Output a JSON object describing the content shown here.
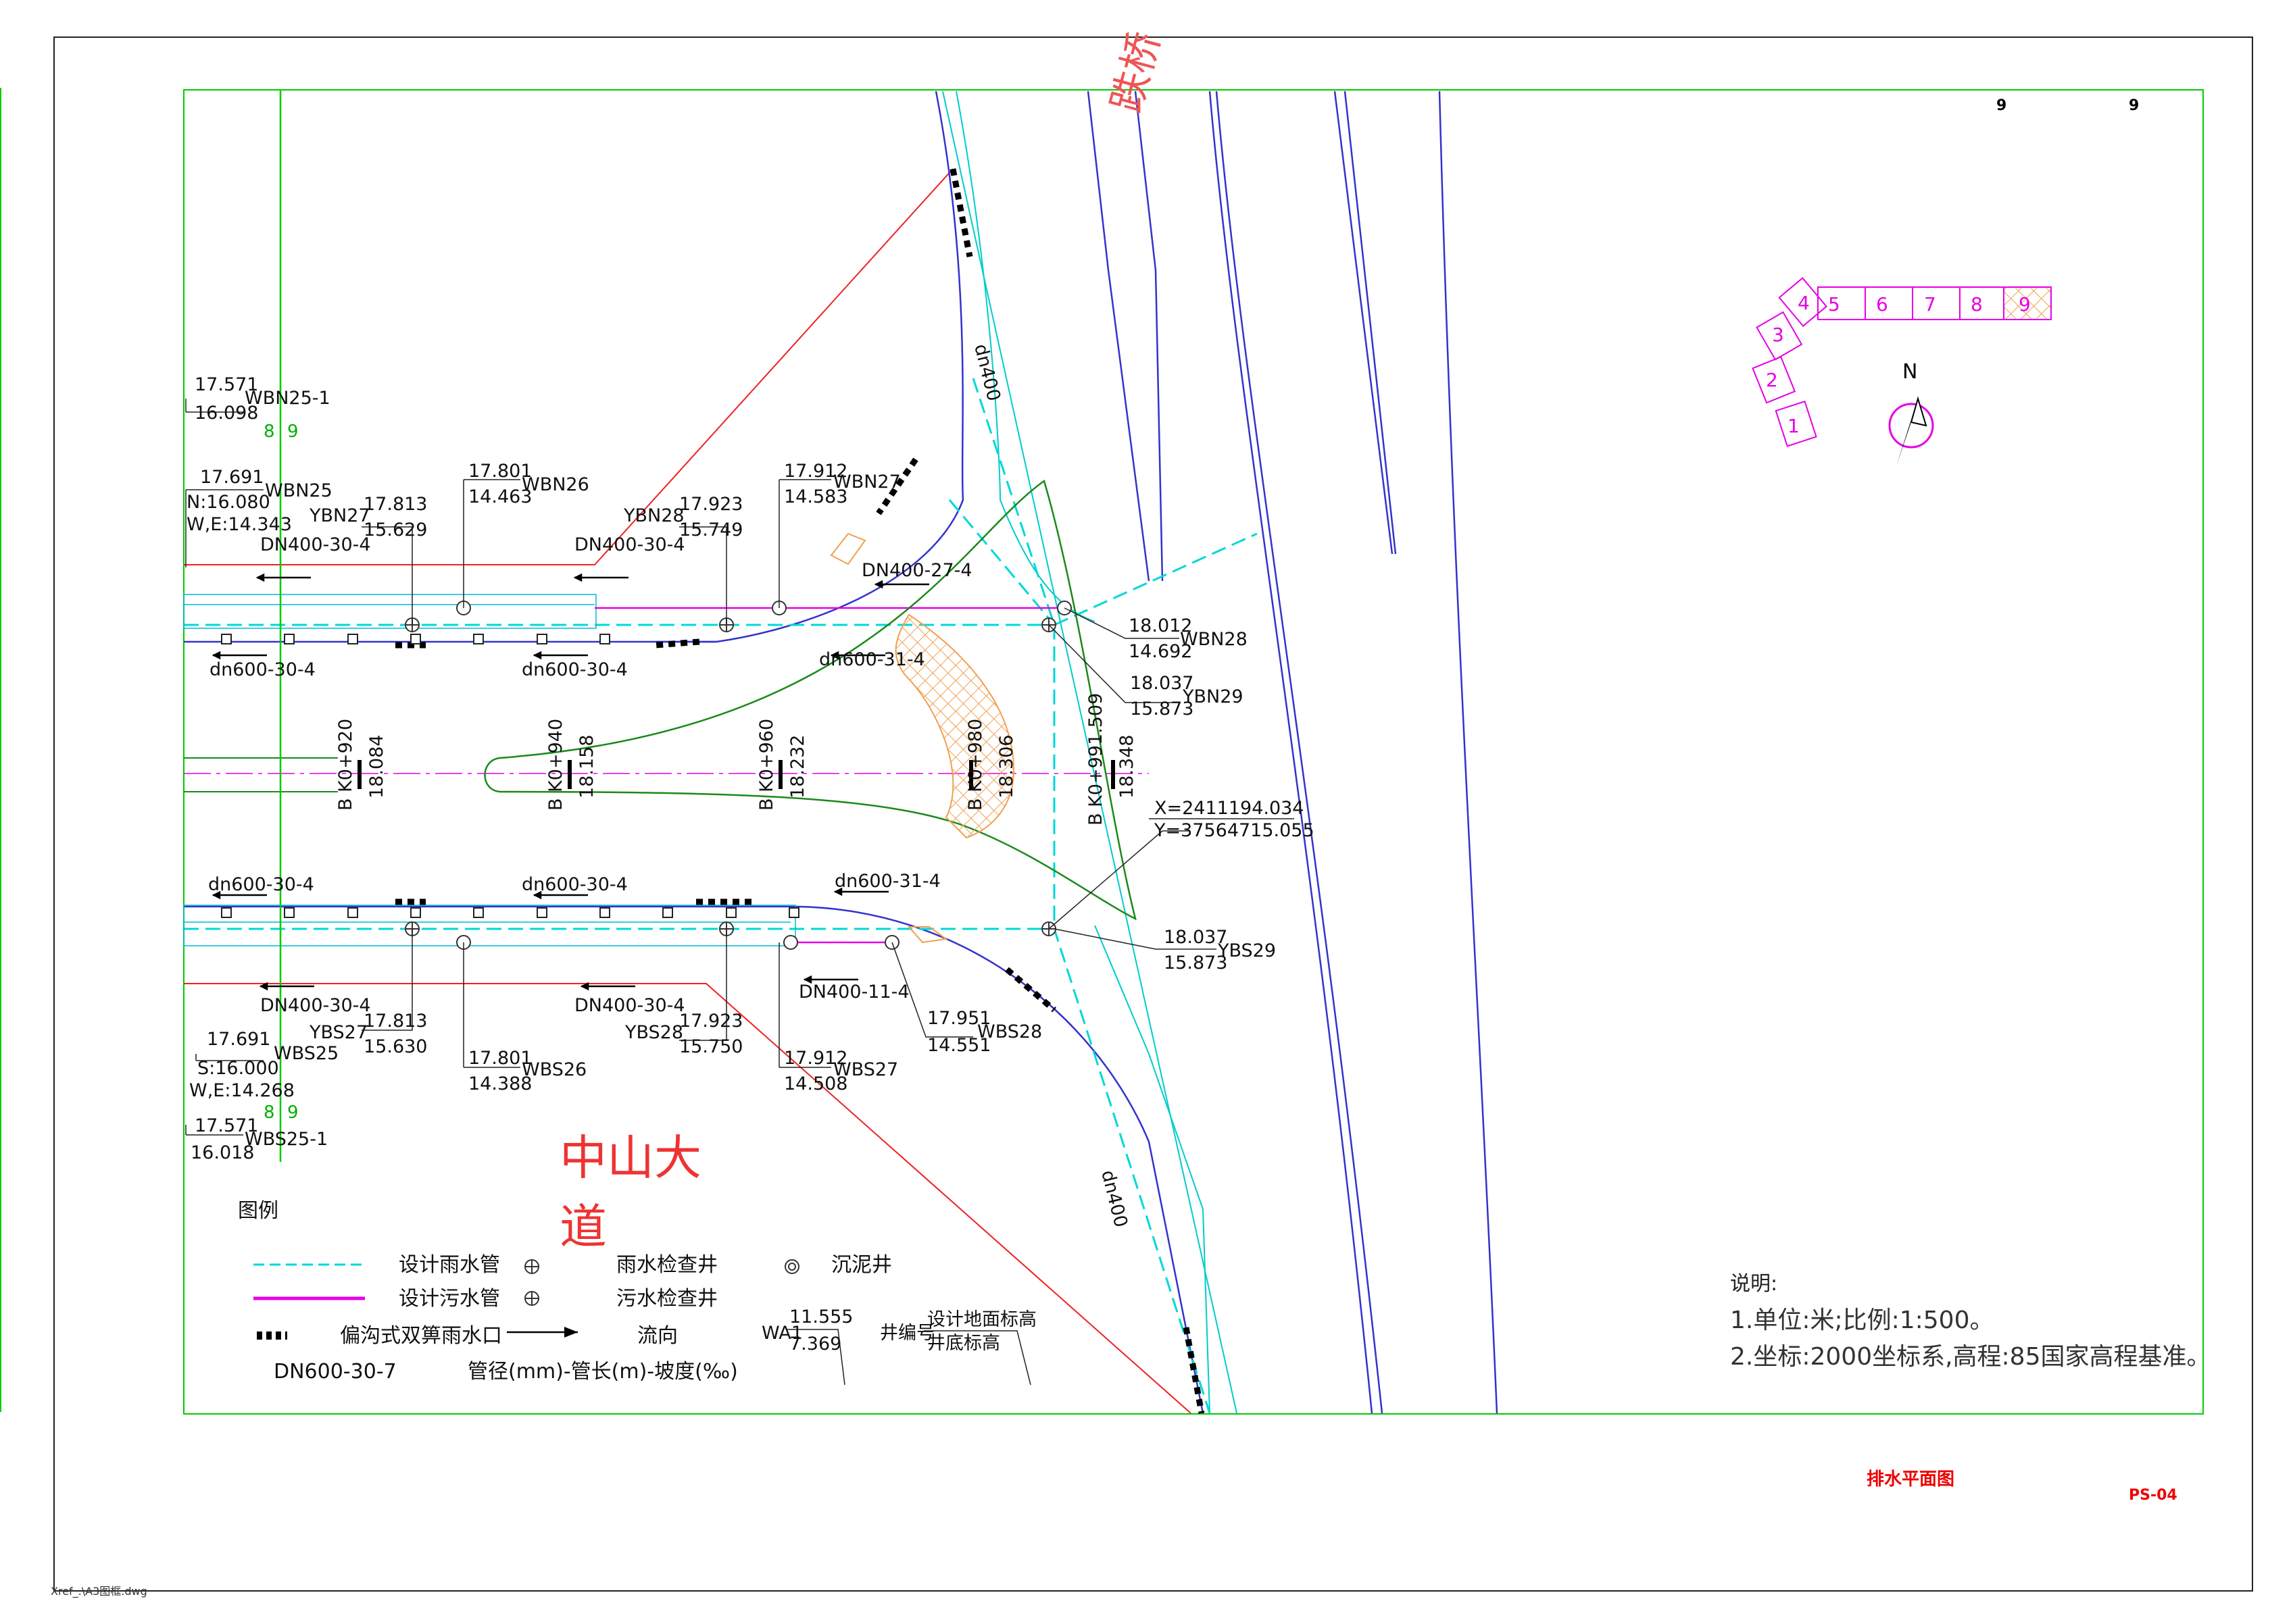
{
  "page": {
    "sheet_title": "排水平面图",
    "sheet_code": "PS-04",
    "xref_path": "Xref_.\\A3图框.dwg",
    "corner_marks": [
      "9",
      "9"
    ]
  },
  "place_names": {
    "road_name_line1": "中山大",
    "road_name_line2": "道",
    "top_text": "跌桥"
  },
  "key_plan": {
    "segments": [
      "1",
      "2",
      "3",
      "4",
      "5",
      "6",
      "7",
      "8",
      "9"
    ],
    "north_label": "N"
  },
  "sheet_match": [
    "8",
    "9"
  ],
  "stations": [
    {
      "chainage": "B K0+920",
      "elev": "18.084"
    },
    {
      "chainage": "B K0+940",
      "elev": "18.158"
    },
    {
      "chainage": "B K0+960",
      "elev": "18.232"
    },
    {
      "chainage": "B K0+980",
      "elev": "18.306"
    },
    {
      "chainage": "B K0+991.509",
      "elev": "18.348"
    }
  ],
  "coordinates": {
    "x": "X=2411194.034",
    "y": "Y=37564715.055"
  },
  "north_wells": [
    {
      "top": "17.571",
      "bottom": "16.098",
      "id": "WBN25-1"
    },
    {
      "top": "17.691",
      "bottom": "N:16.080",
      "bottom2": "W,E:14.343",
      "id": "WBN25"
    },
    {
      "top": "17.813",
      "bottom": "15.629",
      "id": "YBN27"
    },
    {
      "top": "17.801",
      "bottom": "14.463",
      "id": "WBN26"
    },
    {
      "top": "17.923",
      "bottom": "15.749",
      "id": "YBN28"
    },
    {
      "top": "17.912",
      "bottom": "14.583",
      "id": "WBN27"
    },
    {
      "top": "18.012",
      "bottom": "14.692",
      "id": "WBN28"
    },
    {
      "top": "18.037",
      "bottom": "15.873",
      "id": "YBN29"
    }
  ],
  "south_wells": [
    {
      "top": "18.037",
      "bottom": "15.873",
      "id": "YBS29"
    },
    {
      "top": "17.813",
      "bottom": "15.630",
      "id": "YBS27"
    },
    {
      "top": "17.691",
      "bottom": "S:16.000",
      "bottom2": "W,E:14.268",
      "id": "WBS25"
    },
    {
      "top": "17.801",
      "bottom": "14.388",
      "id": "WBS26"
    },
    {
      "top": "17.923",
      "bottom": "15.750",
      "id": "YBS28"
    },
    {
      "top": "17.912",
      "bottom": "14.508",
      "id": "WBS27"
    },
    {
      "top": "17.951",
      "bottom": "14.551",
      "id": "WBS28"
    },
    {
      "top": "17.571",
      "bottom": "16.018",
      "id": "WBS25-1"
    }
  ],
  "pipe_labels": {
    "n_sewer_1": "DN400-30-4",
    "n_sewer_2": "DN400-30-4",
    "n_sewer_3": "DN400-27-4",
    "n_storm_1": "dn600-30-4",
    "n_storm_2": "dn600-30-4",
    "n_storm_3": "dn600-31-4",
    "s_storm_1": "dn600-30-4",
    "s_storm_2": "dn600-30-4",
    "s_storm_3": "dn600-31-4",
    "s_sewer_1": "DN400-30-4",
    "s_sewer_2": "DN400-30-4",
    "s_sewer_3": "DN400-11-4",
    "dn400_top": "dn400",
    "dn400_bottom": "dn400"
  },
  "legend": {
    "title": "图例",
    "storm_pipe": "设计雨水管",
    "sewer_pipe": "设计污水管",
    "inlet": "偏沟式双箅雨水口",
    "storm_well": "雨水检查井",
    "sewer_well": "污水检查井",
    "flow": "流向",
    "settling_well": "沉泥井",
    "pipe_example": "DN600-30-7",
    "pipe_spec": "管径(mm)-管长(m)-坡度(‰)",
    "well_example_id": "WA1",
    "well_example_top": "11.555",
    "well_example_bottom": "7.369",
    "well_id_label": "井编号",
    "ground_elev_label": "设计地面标高",
    "bottom_elev_label": "井底标高"
  },
  "notes": {
    "title": "说明:",
    "line1": "1.单位:米;比例:1:500。",
    "line2": "2.坐标:2000坐标系,高程:85国家高程基准。"
  },
  "colors": {
    "frame_green": "#00cc00",
    "storm_cyan": "#00e5e5",
    "sewer_magenta": "#e600e6",
    "road_blue": "#2222cc",
    "edge_red": "#ee2222",
    "island_green": "#1a8a1a",
    "hatch_orange": "#f0a050"
  }
}
